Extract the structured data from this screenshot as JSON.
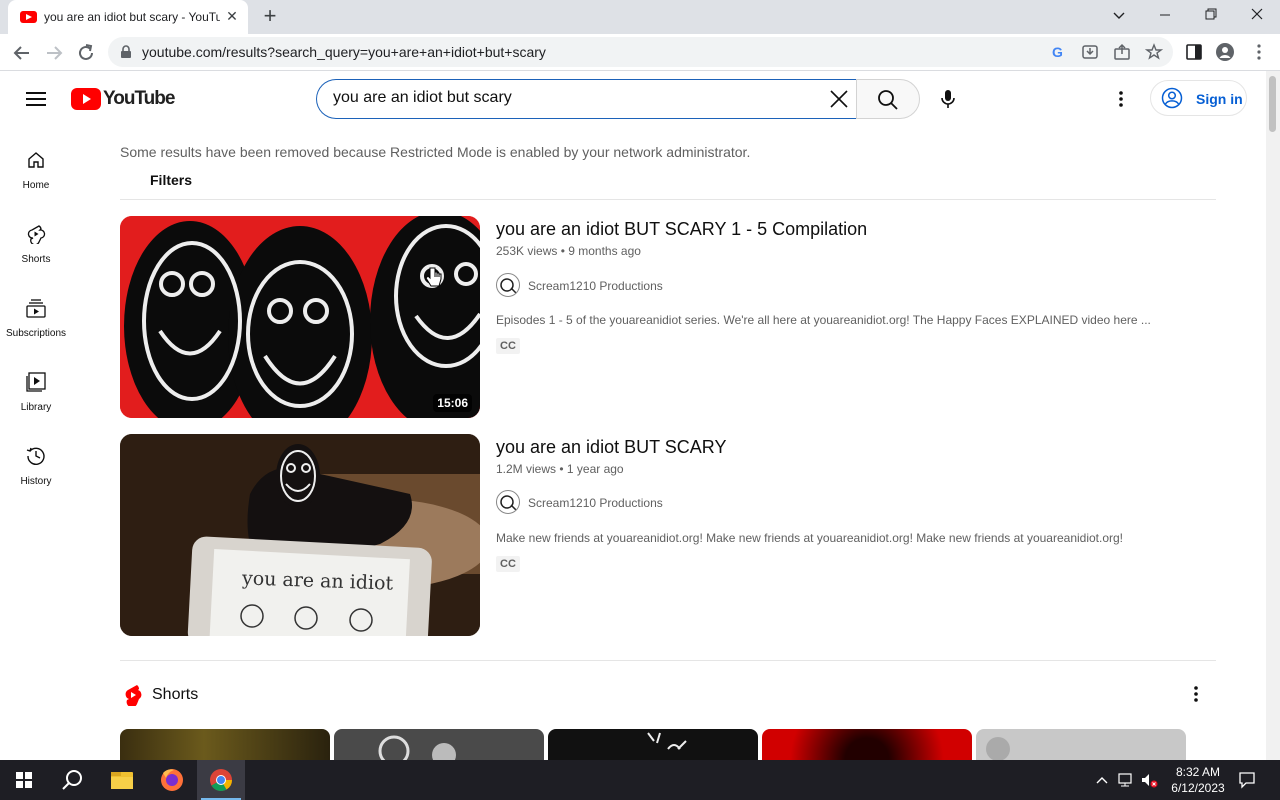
{
  "browser": {
    "tab_title": "you are an idiot but scary - YouTube",
    "url": "youtube.com/results?search_query=you+are+an+idiot+but+scary"
  },
  "masthead": {
    "logo_text": "YouTube",
    "search_value": "you are an idiot but scary",
    "signin_label": "Sign in"
  },
  "guide": {
    "items": [
      {
        "label": "Home",
        "icon": "home-icon"
      },
      {
        "label": "Shorts",
        "icon": "shorts-icon"
      },
      {
        "label": "Subscriptions",
        "icon": "subscriptions-icon"
      },
      {
        "label": "Library",
        "icon": "library-icon"
      },
      {
        "label": "History",
        "icon": "history-icon"
      }
    ]
  },
  "results": {
    "notice": "Some results have been removed because Restricted Mode is enabled by your network administrator.",
    "filters_label": "Filters",
    "videos": [
      {
        "title": "you are an idiot BUT SCARY 1 - 5 Compilation",
        "meta": "253K views • 9 months ago",
        "channel": "Scream1210 Productions",
        "description": "Episodes 1 - 5 of the youareanidiot series. We're all here at youareanidiot.org! The Happy Faces EXPLAINED video here ...",
        "badge": "CC",
        "duration": "15:06"
      },
      {
        "title": "you are an idiot BUT SCARY",
        "meta": "1.2M views • 1 year ago",
        "channel": "Scream1210 Productions",
        "description": "Make new friends at youareanidiot.org! Make new friends at youareanidiot.org! Make new friends at youareanidiot.org!",
        "badge": "CC",
        "thumb_text": "you are an idiot"
      }
    ],
    "shorts_label": "Shorts"
  },
  "taskbar": {
    "time": "8:32 AM",
    "date": "6/12/2023"
  },
  "colors": {
    "youtube_red": "#ff0000",
    "link_blue": "#065fd4",
    "taskbar": "#1e1e24"
  }
}
